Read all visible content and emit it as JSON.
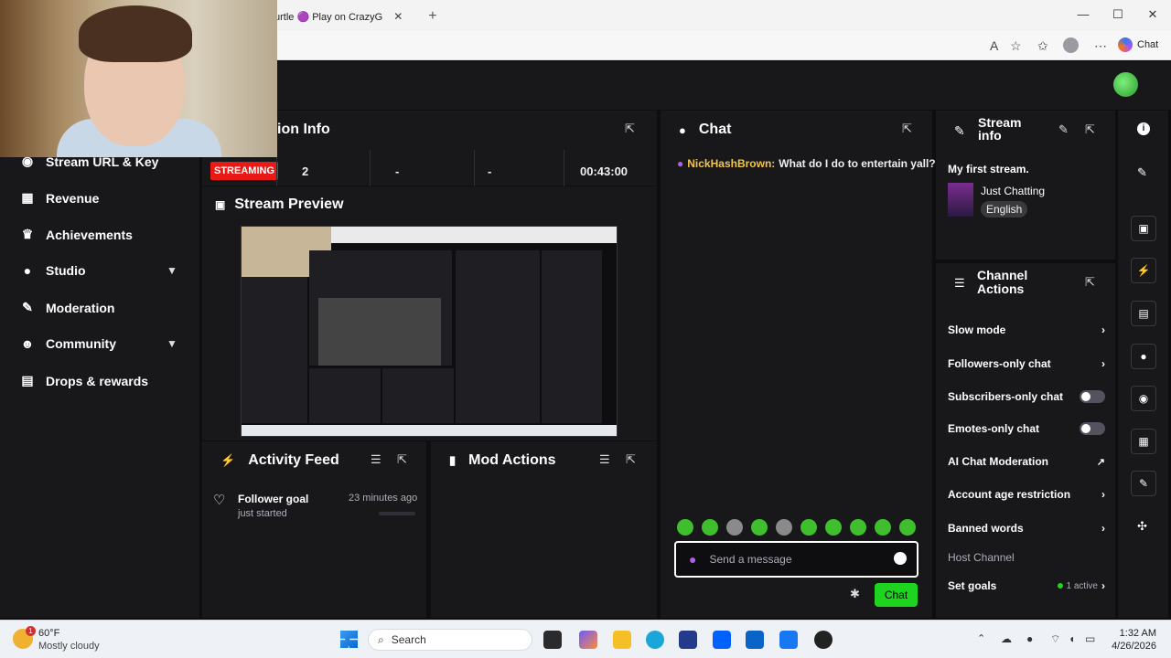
{
  "browser": {
    "tab_title": "urtle 🟣 Play on CrazyG",
    "tab_close": "✕",
    "new_tab": "+",
    "copilot_label": "Chat"
  },
  "stream_info_panel": {
    "title_visible": "ion Info",
    "status_badge": "STREAMING",
    "viewers": "2",
    "followers": "-",
    "subs": "-",
    "duration": "00:43:00"
  },
  "nav": {
    "items": [
      {
        "label": "Stream URL & Key",
        "icon": "key-icon"
      },
      {
        "label": "Revenue",
        "icon": "revenue-icon"
      },
      {
        "label": "Achievements",
        "icon": "trophy-icon"
      },
      {
        "label": "Studio",
        "icon": "studio-icon",
        "expandable": true
      },
      {
        "label": "Moderation",
        "icon": "wrench-icon"
      },
      {
        "label": "Community",
        "icon": "community-icon",
        "expandable": true
      },
      {
        "label": "Drops & rewards",
        "icon": "drops-icon"
      }
    ]
  },
  "preview": {
    "title": "Stream Preview"
  },
  "activity": {
    "title": "Activity Feed",
    "item_title": "Follower goal",
    "item_sub": "just started",
    "item_time": "23 minutes ago"
  },
  "mod_actions": {
    "title": "Mod Actions"
  },
  "chat": {
    "title": "Chat",
    "message_user": "NickHashBrown:",
    "message_text": "What do I do to entertain yall?",
    "input_placeholder": "Send a message",
    "send_label": "Chat"
  },
  "stream_info": {
    "title": "Stream info",
    "stream_title": "My first stream.",
    "category": "Just Chatting",
    "language": "English"
  },
  "channel_actions": {
    "title": "Channel Actions",
    "rows": {
      "slow": "Slow mode",
      "followers": "Followers-only chat",
      "subscribers": "Subscribers-only chat",
      "emotes": "Emotes-only chat",
      "ai": "AI Chat Moderation",
      "age": "Account age restriction",
      "banned": "Banned words",
      "host": "Host Channel",
      "goals": "Set goals",
      "goals_status": "1 active"
    }
  },
  "taskbar": {
    "weather_temp": "60°F",
    "weather_desc": "Mostly cloudy",
    "weather_badge": "1",
    "search_label": "Search",
    "time": "1:32 AM",
    "date": "4/26/2026"
  },
  "colors": {
    "live_red": "#e91916",
    "accent_green": "#1fd41f",
    "panel_bg": "#18181b",
    "page_bg": "#0e0e10"
  }
}
